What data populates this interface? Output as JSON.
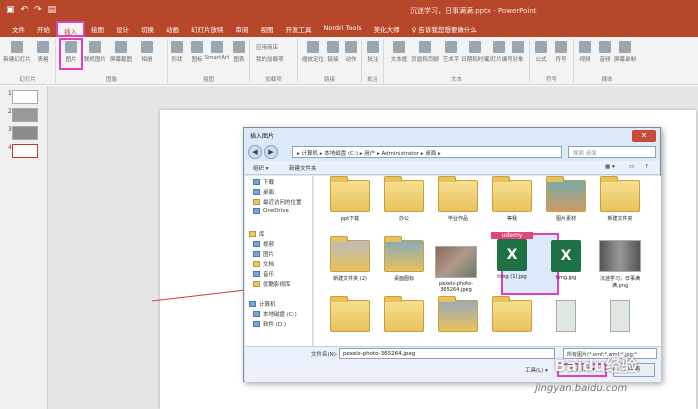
{
  "window": {
    "title": "沉迷学习，日事满满.pptx  -  PowerPoint"
  },
  "tabs": [
    "文件",
    "开始",
    "插入",
    "绘图",
    "设计",
    "切换",
    "动画",
    "幻灯片放映",
    "审阅",
    "视图",
    "开发工具",
    "Nordri Tools",
    "美化大师",
    "♀ 告诉我您想要做什么"
  ],
  "active_tab": "插入",
  "ribbon": {
    "buttons": [
      "新建幻灯片",
      "表格",
      "图片",
      "联机图片",
      "屏幕截图",
      "相册",
      "形状",
      "图标",
      "3D模型",
      "SmartArt",
      "图表",
      "应用商店",
      "我的加载项",
      "缩放定位",
      "链接",
      "动作",
      "批注",
      "文本框",
      "页眉和页脚",
      "艺术字",
      "日期和时间",
      "幻灯片编号",
      "对象",
      "公式",
      "符号",
      "视频",
      "音频",
      "屏幕录制"
    ],
    "groups": [
      "幻灯片",
      "表格",
      "图像",
      "插图",
      "加载项",
      "链接",
      "批注",
      "文本",
      "符号",
      "媒体"
    ]
  },
  "slides": [
    {
      "n": "1"
    },
    {
      "n": "2"
    },
    {
      "n": "3"
    },
    {
      "n": "4"
    }
  ],
  "dialog": {
    "title": "插入图片",
    "close": "✕",
    "back": "◀",
    "forward": "▶",
    "address": "▸ 计算机 ▸ 本地磁盘 (C:) ▸ 用户 ▸ Administrator ▸ 桌面 ▸",
    "search_placeholder": "搜索 桌面",
    "toolbar": {
      "organize": "组织 ▾",
      "new_folder": "新建文件夹"
    },
    "nav": [
      "下载",
      "桌面",
      "最近访问的位置",
      "OneDrive",
      "库",
      "视频",
      "图片",
      "文档",
      "音乐",
      "优酷影视库",
      "计算机",
      "本地磁盘 (C:)",
      "软件 (D:)"
    ],
    "files": [
      {
        "name": "ppt下载",
        "kind": "folder"
      },
      {
        "name": "办公",
        "kind": "folder"
      },
      {
        "name": "毕业作品",
        "kind": "folder"
      },
      {
        "name": "等我",
        "kind": "folder"
      },
      {
        "name": "图片素材",
        "kind": "folder"
      },
      {
        "name": "新建文件夹",
        "kind": "folder"
      },
      {
        "name": "新建文件夹 (2)",
        "kind": "folder"
      },
      {
        "name": "桌面图标",
        "kind": "folder"
      },
      {
        "name": "pexels-photo-365264.jpeg",
        "kind": "image"
      },
      {
        "name": "timg (1).jpg",
        "kind": "excel"
      },
      {
        "name": "timg.jpg",
        "kind": "excel"
      },
      {
        "name": "沉迷学习，日事满满.png",
        "kind": "image"
      }
    ],
    "udemy_label": "udemy",
    "filename_label": "文件名(N):",
    "filename_value": "pexels-photo-365264.jpeg",
    "filetype": "所有图片(*.emf;*.wmf;*.jpg;*",
    "tools": "工具(L) ▾",
    "insert": "插入(S) ▾",
    "cancel": "取消"
  },
  "watermark": "jingyan.baidu.com",
  "watermark_logo": "Baidu经验"
}
